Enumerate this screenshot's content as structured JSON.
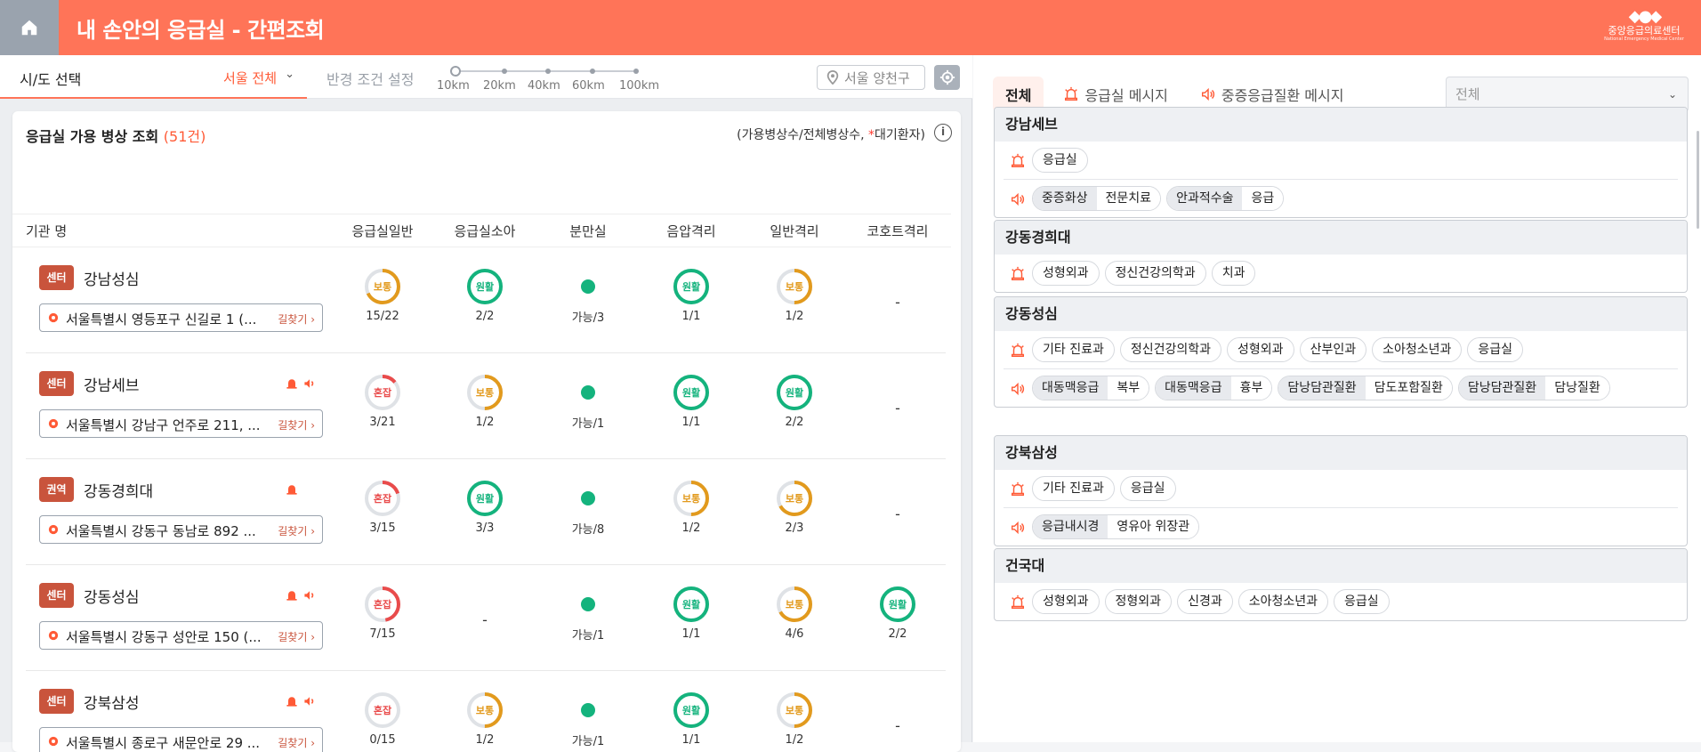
{
  "header": {
    "title": "내 손안의 응급실 - 간편조회",
    "logo_text": "중앙응급의료센터",
    "logo_sub": "National Emergency Medical Center"
  },
  "filters": {
    "region_label": "시/도 선택",
    "region_value": "서울 전체",
    "radius_label": "반경 조건 설정",
    "radius_options": [
      "10km",
      "20km",
      "40km",
      "60km",
      "100km"
    ],
    "location": "서울 양천구"
  },
  "list": {
    "title": "응급실 가용 병상 조회",
    "count": "(51건)",
    "legend_prefix": "(가용병상수/전체병상수, ",
    "legend_star": "*",
    "legend_suffix": "대기환자)",
    "info": "i",
    "columns": [
      "기관 명",
      "응급실일반",
      "응급실소아",
      "분만실",
      "음압격리",
      "일반격리",
      "코호트격리"
    ],
    "way_label": "길찾기 ›",
    "rows": [
      {
        "badge": "센터",
        "name": "강남성심",
        "addr": "서울특별시 영등포구 신길로 1 (...",
        "bell": false,
        "speaker": false,
        "c1": {
          "status": "보통",
          "ratio": 0.68,
          "color": "#e29a1d",
          "num": "15/22"
        },
        "c2": {
          "status": "원활",
          "ratio": 1,
          "color": "#14b37d",
          "num": "2/2"
        },
        "c3": {
          "num": "가능/3"
        },
        "c4": {
          "status": "원활",
          "ratio": 1,
          "color": "#14b37d",
          "num": "1/1"
        },
        "c5": {
          "status": "보통",
          "ratio": 0.5,
          "color": "#e29a1d",
          "num": "1/2"
        },
        "c6": {
          "num": "-"
        }
      },
      {
        "badge": "센터",
        "name": "강남세브",
        "addr": "서울특별시 강남구 언주로 211, ...",
        "bell": true,
        "speaker": true,
        "c1": {
          "status": "혼잡",
          "ratio": 0.14,
          "color": "#e94b4b",
          "num": "3/21"
        },
        "c2": {
          "status": "보통",
          "ratio": 0.5,
          "color": "#e29a1d",
          "num": "1/2"
        },
        "c3": {
          "num": "가능/1"
        },
        "c4": {
          "status": "원활",
          "ratio": 1,
          "color": "#14b37d",
          "num": "1/1"
        },
        "c5": {
          "status": "원활",
          "ratio": 1,
          "color": "#14b37d",
          "num": "2/2"
        },
        "c6": {
          "num": "-"
        }
      },
      {
        "badge": "권역",
        "name": "강동경희대",
        "addr": "서울특별시 강동구 동남로 892 ...",
        "bell": true,
        "speaker": false,
        "c1": {
          "status": "혼잡",
          "ratio": 0.2,
          "color": "#e94b4b",
          "num": "3/15"
        },
        "c2": {
          "status": "원활",
          "ratio": 1,
          "color": "#14b37d",
          "num": "3/3"
        },
        "c3": {
          "num": "가능/8"
        },
        "c4": {
          "status": "보통",
          "ratio": 0.5,
          "color": "#e29a1d",
          "num": "1/2"
        },
        "c5": {
          "status": "보통",
          "ratio": 0.67,
          "color": "#e29a1d",
          "num": "2/3"
        },
        "c6": {
          "num": "-"
        }
      },
      {
        "badge": "센터",
        "name": "강동성심",
        "addr": "서울특별시 강동구 성안로 150 (...",
        "bell": true,
        "speaker": true,
        "c1": {
          "status": "혼잡",
          "ratio": 0.47,
          "color": "#e94b4b",
          "num": "7/15"
        },
        "c2": {
          "num": "-"
        },
        "c3": {
          "num": "가능/1"
        },
        "c4": {
          "status": "원활",
          "ratio": 1,
          "color": "#14b37d",
          "num": "1/1"
        },
        "c5": {
          "status": "보통",
          "ratio": 0.67,
          "color": "#e29a1d",
          "num": "4/6"
        },
        "c6": {
          "status": "원활",
          "ratio": 1,
          "color": "#14b37d",
          "num": "2/2"
        }
      },
      {
        "badge": "센터",
        "name": "강북삼성",
        "addr": "서울특별시 종로구 새문안로 29 ...",
        "bell": true,
        "speaker": true,
        "c1": {
          "status": "혼잡",
          "ratio": 0,
          "color": "#e94b4b",
          "num": "0/15"
        },
        "c2": {
          "status": "보통",
          "ratio": 0.5,
          "color": "#e29a1d",
          "num": "1/2"
        },
        "c3": {
          "num": "가능/1"
        },
        "c4": {
          "status": "원활",
          "ratio": 1,
          "color": "#14b37d",
          "num": "1/1"
        },
        "c5": {
          "status": "보통",
          "ratio": 0.5,
          "color": "#e29a1d",
          "num": "1/2"
        },
        "c6": {
          "num": "-"
        }
      }
    ]
  },
  "messages": {
    "tabs": [
      "전체",
      "응급실 메시지",
      "중증응급질환 메시지"
    ],
    "type_select": "전체",
    "hospitals": [
      {
        "name": "강남세브",
        "er": [
          "응급실"
        ],
        "severe": [
          [
            "중증화상",
            "전문치료"
          ],
          [
            "안과적수술",
            "응급"
          ]
        ]
      },
      {
        "name": "강동경희대",
        "er": [
          "성형외과",
          "정신건강의학과",
          "치과"
        ],
        "severe": []
      },
      {
        "name": "강동성심",
        "er": [
          "기타 진료과",
          "정신건강의학과",
          "성형외과",
          "산부인과",
          "소아청소년과",
          "응급실"
        ],
        "severe": [
          [
            "대동맥응급",
            "복부"
          ],
          [
            "대동맥응급",
            "흉부"
          ],
          [
            "담낭담관질환",
            "담도포함질환"
          ],
          [
            "담낭담관질환",
            "담낭질환"
          ]
        ]
      },
      {
        "name": "강북삼성",
        "er": [
          "기타 진료과",
          "응급실"
        ],
        "severe": [
          [
            "응급내시경",
            "영유아 위장관"
          ]
        ]
      },
      {
        "name": "건국대",
        "er": [
          "성형외과",
          "정형외과",
          "신경과",
          "소아청소년과",
          "응급실"
        ],
        "severe": []
      }
    ]
  },
  "colors": {
    "brand": "#ff7458",
    "good": "#14b37d",
    "normal": "#e29a1d",
    "busy": "#e94b4b",
    "badge": "#c9543c"
  }
}
